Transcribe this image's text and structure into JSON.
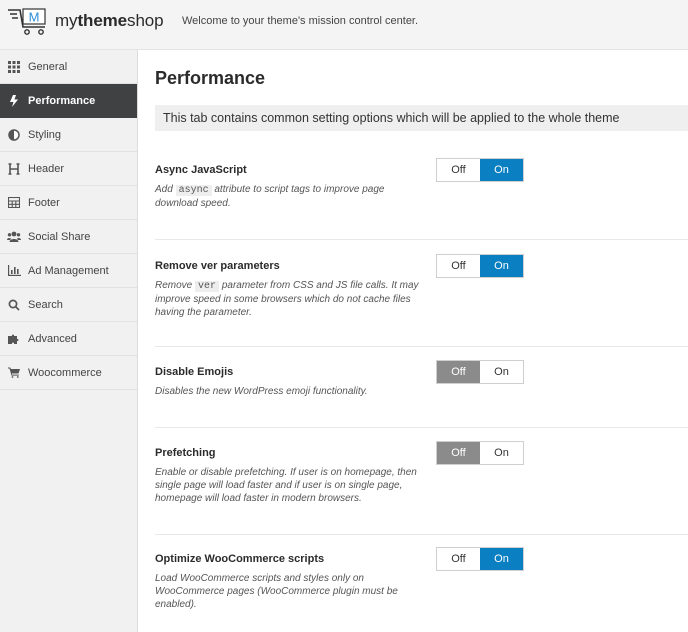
{
  "header": {
    "logo_text_light": "my",
    "logo_text_bold": "theme",
    "logo_text_end": "shop",
    "logo_mark": "M",
    "tagline": "Welcome to your theme's mission control center."
  },
  "sidebar": {
    "items": [
      {
        "label": "General",
        "icon": "grid-icon",
        "active": false
      },
      {
        "label": "Performance",
        "icon": "bolt-icon",
        "active": true
      },
      {
        "label": "Styling",
        "icon": "contrast-icon",
        "active": false
      },
      {
        "label": "Header",
        "icon": "header-icon",
        "active": false
      },
      {
        "label": "Footer",
        "icon": "table-icon",
        "active": false
      },
      {
        "label": "Social Share",
        "icon": "users-icon",
        "active": false
      },
      {
        "label": "Ad Management",
        "icon": "bar-chart-icon",
        "active": false
      },
      {
        "label": "Search",
        "icon": "search-icon",
        "active": false
      },
      {
        "label": "Advanced",
        "icon": "puzzle-icon",
        "active": false
      },
      {
        "label": "Woocommerce",
        "icon": "cart-icon",
        "active": false
      }
    ]
  },
  "main": {
    "title": "Performance",
    "notice": "This tab contains common setting options which will be applied to the whole theme",
    "settings": [
      {
        "title": "Async JavaScript",
        "desc_before": "Add",
        "desc_code": "async",
        "desc_after": "attribute to script tags to improve page download speed.",
        "off_label": "Off",
        "on_label": "On",
        "value": "on"
      },
      {
        "title": "Remove ver parameters",
        "desc_before": "Remove",
        "desc_code": "ver",
        "desc_after": "parameter from CSS and JS file calls. It may improve speed in some browsers which do not cache files having the parameter.",
        "off_label": "Off",
        "on_label": "On",
        "value": "on"
      },
      {
        "title": "Disable Emojis",
        "desc": "Disables the new WordPress emoji functionality.",
        "off_label": "Off",
        "on_label": "On",
        "value": "off"
      },
      {
        "title": "Prefetching",
        "desc": "Enable or disable prefetching. If user is on homepage, then single page will load faster and if user is on single page, homepage will load faster in modern browsers.",
        "off_label": "Off",
        "on_label": "On",
        "value": "off"
      },
      {
        "title": "Optimize WooCommerce scripts",
        "desc": "Load WooCommerce scripts and styles only on WooCommerce pages (WooCommerce plugin must be enabled).",
        "off_label": "Off",
        "on_label": "On",
        "value": "on"
      }
    ]
  },
  "colors": {
    "accent": "#0a7fc1",
    "sidebar_active": "#3f4142",
    "toggle_off_active": "#8b8b8b",
    "logo_blue": "#2a8fd6"
  }
}
